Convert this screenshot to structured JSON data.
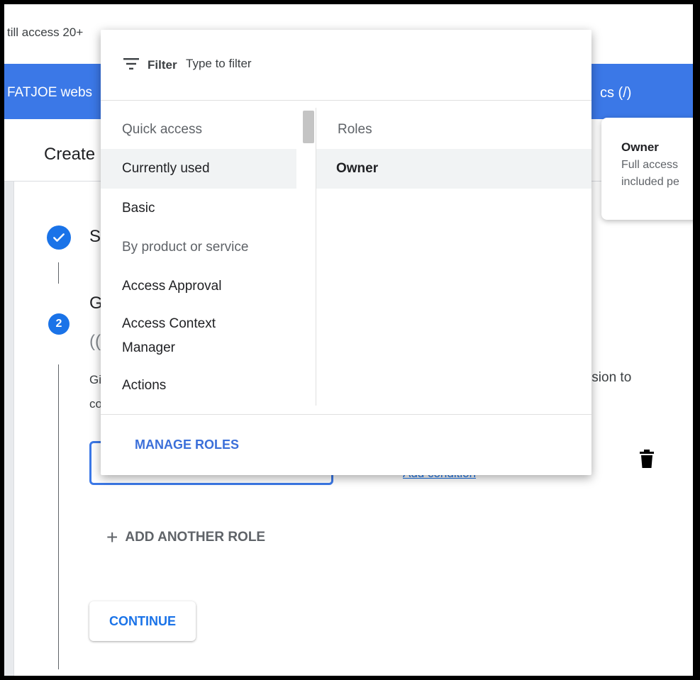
{
  "background": {
    "banner_text": "till access 20+",
    "bluebar_left": "FATJOE webs",
    "bluebar_right": "cs (/)",
    "header_title": "Create",
    "step1": {
      "letter": "S"
    },
    "step2": {
      "number": "2",
      "letter": "G",
      "paren": "(("
    },
    "description": {
      "left_line1": "Gi",
      "left_line2": "co",
      "right": "nission to"
    },
    "add_condition_label": "Add condition",
    "add_another_role_label": "ADD ANOTHER ROLE",
    "continue_label": "CONTINUE"
  },
  "tooltip": {
    "title": "Owner",
    "line1": "Full access",
    "line2": "included pe"
  },
  "dropdown": {
    "filter_label": "Filter",
    "filter_placeholder": "Type to filter",
    "left": {
      "quick_access_header": "Quick access",
      "quick_items": [
        {
          "label": "Currently used",
          "selected": true
        },
        {
          "label": "Basic",
          "selected": false
        }
      ],
      "by_product_header": "By product or service",
      "product_items": [
        {
          "label": "Access Approval"
        },
        {
          "label": "Access Context Manager"
        },
        {
          "label": "Actions"
        }
      ]
    },
    "right": {
      "roles_header": "Roles",
      "role_items": [
        {
          "label": "Owner",
          "selected": true
        }
      ]
    },
    "manage_roles_label": "MANAGE ROLES"
  },
  "colors": {
    "accent": "#1a73e8",
    "bluebar": "#3b78e7",
    "selected_row": "#f1f3f4"
  }
}
